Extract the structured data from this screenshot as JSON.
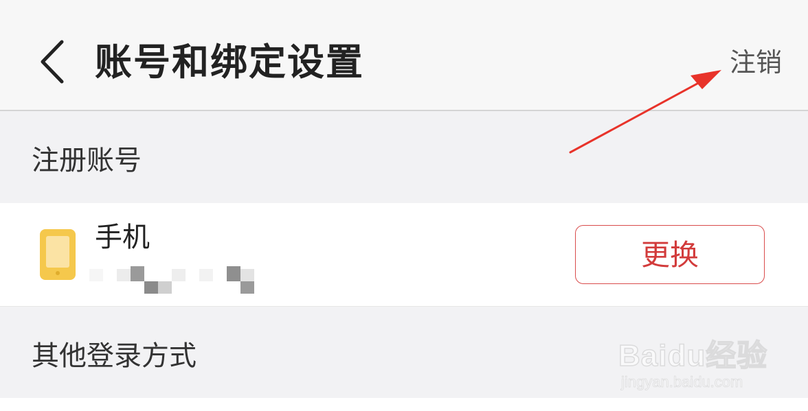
{
  "header": {
    "title": "账号和绑定设置",
    "logout_label": "注销"
  },
  "sections": {
    "registered": {
      "label": "注册账号"
    },
    "other_login": {
      "label": "其他登录方式"
    }
  },
  "phone": {
    "label": "手机",
    "change_label": "更换",
    "icon": "phone-icon"
  },
  "watermark": {
    "logo_text": "Baidu经验",
    "url": "jingyan.baidu.com"
  },
  "colors": {
    "accent_red": "#d23b3b",
    "phone_icon_yellow": "#f5c84c",
    "annotation_arrow": "#e8332a"
  }
}
